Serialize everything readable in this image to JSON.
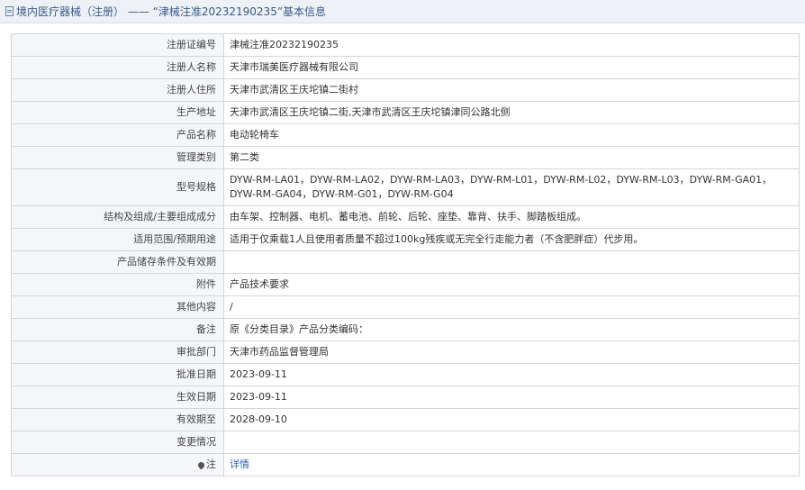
{
  "header": {
    "title": "境内医疗器械（注册） —— “津械注准20232190235”基本信息"
  },
  "rows": [
    {
      "label": "注册证编号",
      "value": "津械注准20232190235"
    },
    {
      "label": "注册人名称",
      "value": "天津市瑞美医疗器械有限公司"
    },
    {
      "label": "注册人住所",
      "value": "天津市武清区王庆坨镇二街村"
    },
    {
      "label": "生产地址",
      "value": "天津市武清区王庆坨镇二街,天津市武清区王庆坨镇津同公路北侧"
    },
    {
      "label": "产品名称",
      "value": "电动轮椅车"
    },
    {
      "label": "管理类别",
      "value": "第二类"
    },
    {
      "label": "型号规格",
      "value": "DYW-RM-LA01，DYW-RM-LA02，DYW-RM-LA03，DYW-RM-L01，DYW-RM-L02，DYW-RM-L03，DYW-RM-GA01，DYW-RM-GA04，DYW-RM-G01，DYW-RM-G04"
    },
    {
      "label": "结构及组成/主要组成成分",
      "value": "由车架、控制器、电机、蓄电池、前轮、后轮、座垫、靠背、扶手、脚踏板组成。"
    },
    {
      "label": "适用范围/预期用途",
      "value": "适用于仅乘载1人且使用者质量不超过100kg残疾或无完全行走能力者（不含肥胖症）代步用。"
    },
    {
      "label": "产品储存条件及有效期",
      "value": ""
    },
    {
      "label": "附件",
      "value": "产品技术要求"
    },
    {
      "label": "其他内容",
      "value": "/"
    },
    {
      "label": "备注",
      "value": "原《分类目录》产品分类编码："
    },
    {
      "label": "审批部门",
      "value": "天津市药品监督管理局"
    },
    {
      "label": "批准日期",
      "value": "2023-09-11"
    },
    {
      "label": "生效日期",
      "value": "2023-09-11"
    },
    {
      "label": "有效期至",
      "value": "2028-09-10"
    },
    {
      "label": "变更情况",
      "value": ""
    },
    {
      "label": "注",
      "value": "详情"
    }
  ]
}
